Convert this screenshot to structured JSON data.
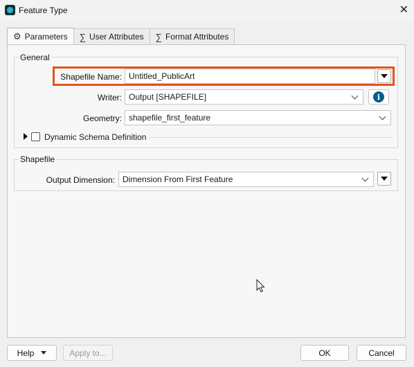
{
  "window": {
    "title": "Feature Type",
    "close_icon": "close-icon"
  },
  "tabs": [
    {
      "label": "Parameters",
      "icon": "gear-icon",
      "active": true
    },
    {
      "label": "User Attributes",
      "icon": "sigma-icon",
      "active": false
    },
    {
      "label": "Format Attributes",
      "icon": "sigma-icon",
      "active": false
    }
  ],
  "general": {
    "title": "General",
    "shapefile_name": {
      "label": "Shapefile Name:",
      "value": "Untitled_PublicArt"
    },
    "writer": {
      "label": "Writer:",
      "value": "Output [SHAPEFILE]"
    },
    "geometry": {
      "label": "Geometry:",
      "value": "shapefile_first_feature"
    },
    "dynamic_schema": {
      "label": "Dynamic Schema Definition",
      "checked": false
    }
  },
  "shapefile": {
    "title": "Shapefile",
    "output_dimension": {
      "label": "Output Dimension:",
      "value": "Dimension From First Feature"
    }
  },
  "footer": {
    "help": "Help",
    "apply": "Apply to...",
    "ok": "OK",
    "cancel": "Cancel"
  },
  "colors": {
    "highlight": "#e2541c",
    "info": "#0a5d8a",
    "app_icon": "#22b7c8"
  }
}
